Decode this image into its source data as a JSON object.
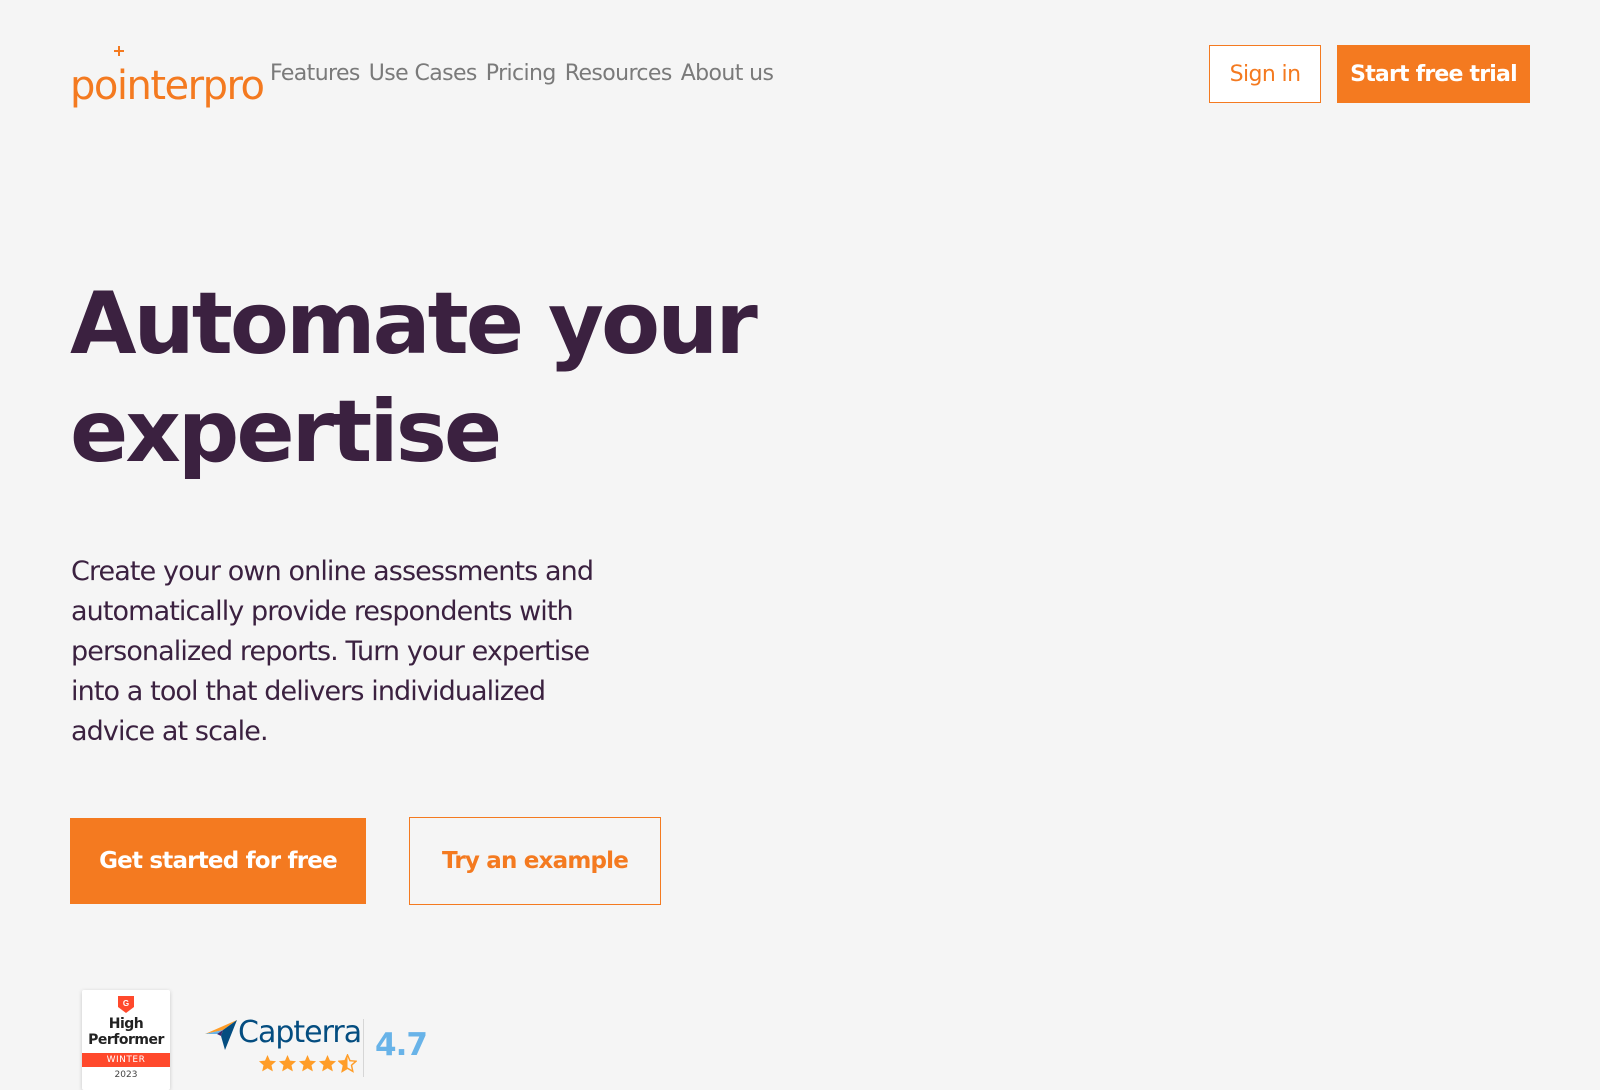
{
  "brand": {
    "name": "pointerpro",
    "accent": "#f47a20",
    "text_dark": "#3b2140"
  },
  "nav": {
    "items": [
      {
        "label": "Features"
      },
      {
        "label": "Use Cases"
      },
      {
        "label": "Pricing"
      },
      {
        "label": "Resources"
      },
      {
        "label": "About us"
      }
    ]
  },
  "header": {
    "signin_label": "Sign in",
    "trial_label": "Start free trial"
  },
  "hero": {
    "title": "Automate your expertise",
    "description": "Create your own online assessments and automatically provide respondents with personalized reports. Turn your expertise into a tool that delivers individualized advice at scale.",
    "primary_cta": "Get started for free",
    "secondary_cta": "Try an example"
  },
  "badges": {
    "g2": {
      "line1": "High",
      "line2": "Performer",
      "season": "WINTER",
      "year": "2023",
      "icon": "g2-logo-icon",
      "color": "#ff492c"
    },
    "capterra": {
      "name": "Capterra",
      "score": "4.7",
      "stars": 4.5,
      "icon": "capterra-arrow-icon",
      "name_color": "#044d80",
      "score_color": "#68b3e8",
      "star_color": "#ff9d28"
    }
  }
}
